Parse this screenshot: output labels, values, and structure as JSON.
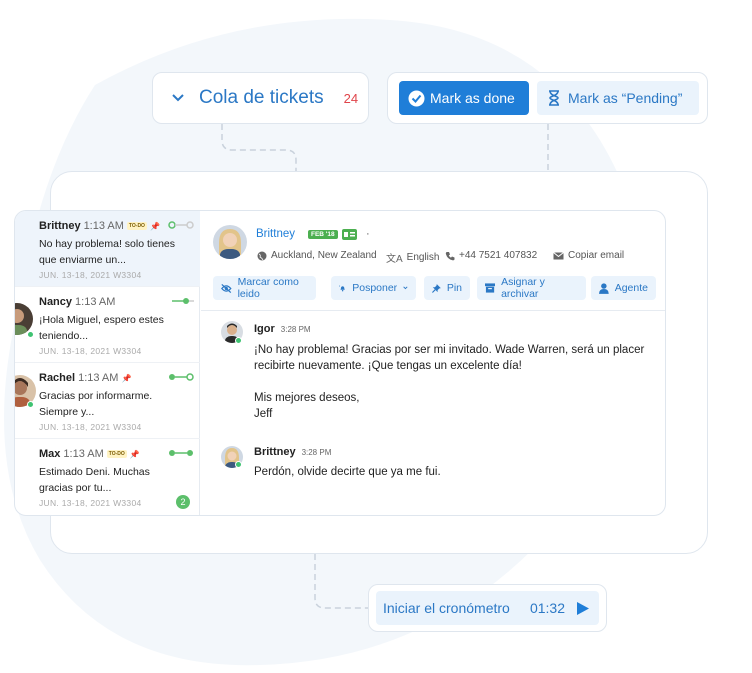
{
  "queue": {
    "label": "Cola de tickets",
    "count": "24"
  },
  "actions": {
    "done_label": "Mark as done",
    "pending_label": "Mark as “Pending”"
  },
  "conversations": [
    {
      "name": "Brittney",
      "time": "1:13 AM",
      "todo": "TO-DO",
      "preview": "No hay problema! solo tienes que enviarme un...",
      "date": "JUN. 13-18, 2021 W3304"
    },
    {
      "name": "Nancy",
      "time": "1:13 AM",
      "preview": "¡Hola Miguel, espero estes teniendo...",
      "date": "JUN. 13-18, 2021 W3304"
    },
    {
      "name": "Rachel",
      "time": "1:13 AM",
      "preview": "Gracias por informarme. Siempre y...",
      "date": "JUN. 13-18, 2021 W3304"
    },
    {
      "name": "Max",
      "time": "1:13 AM",
      "todo": "TO-DO",
      "preview": "Estimado Deni. Muchas gracias por tu...",
      "date": "JUN. 13-18, 2021 W3304",
      "badge": "2"
    }
  ],
  "contact": {
    "name": "Brittney",
    "tag": "FEB '18",
    "location": "Auckland, New Zealand",
    "language": "English",
    "phone": "+44 7521 407832",
    "email": "Copiar email",
    "dot": "·"
  },
  "toolbar": {
    "mark_read": "Marcar como leido",
    "postpone": "Posponer",
    "pin": "Pin",
    "assign_archive": "Asignar y archivar",
    "agent": "Agente"
  },
  "messages": [
    {
      "author": "Igor",
      "time": "3:28 PM",
      "lines": [
        "¡No hay problema! Gracias por ser mi invitado. Wade Warren, será un placer",
        "recibirte nuevamente. ¡Que tengas un excelente día!",
        "",
        "Mis mejores deseos,",
        "Jeff"
      ]
    },
    {
      "author": "Brittney",
      "time": "3:28 PM",
      "lines": [
        "Perdón, olvide decirte que ya me fui."
      ]
    }
  ],
  "timer": {
    "label": "Iniciar el cronómetro",
    "value": "01:32"
  },
  "colors": {
    "accent": "#1f7ed8",
    "accent_light": "#eaf3fc",
    "count": "#e0444a",
    "online": "#3fc372",
    "tag": "#4caf50"
  }
}
